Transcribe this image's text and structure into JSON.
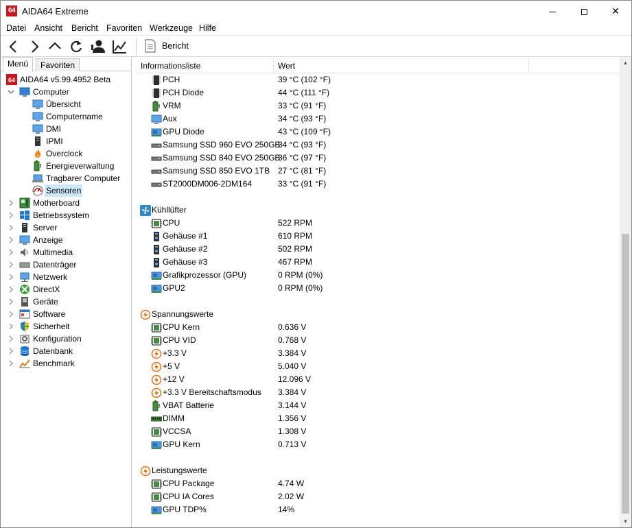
{
  "window": {
    "title": "AIDA64 Extreme",
    "logo_text": "64",
    "close_glyph": "✕"
  },
  "menubar": [
    "Datei",
    "Ansicht",
    "Bericht",
    "Favoriten",
    "Werkzeuge",
    "Hilfe"
  ],
  "toolbar": {
    "report_label": "Bericht",
    "icons": [
      "back-icon",
      "forward-icon",
      "up-icon",
      "refresh-icon",
      "user-icon",
      "chart-icon"
    ]
  },
  "left_panel": {
    "tabs": [
      "Menü",
      "Favoriten"
    ],
    "active_tab": "Menü",
    "tree": [
      {
        "label": "AIDA64 v5.99.4952 Beta",
        "level": 0,
        "icon": "aida64-icon"
      },
      {
        "label": "Computer",
        "level": 1,
        "icon": "computer-icon",
        "expanded": true
      },
      {
        "label": "Übersicht",
        "level": 2,
        "icon": "monitor-icon"
      },
      {
        "label": "Computername",
        "level": 2,
        "icon": "monitor-icon"
      },
      {
        "label": "DMI",
        "level": 2,
        "icon": "monitor-icon"
      },
      {
        "label": "IPMI",
        "level": 2,
        "icon": "server-icon"
      },
      {
        "label": "Overclock",
        "level": 2,
        "icon": "flame-icon"
      },
      {
        "label": "Energieverwaltung",
        "level": 2,
        "icon": "battery-icon"
      },
      {
        "label": "Tragbarer Computer",
        "level": 2,
        "icon": "laptop-icon"
      },
      {
        "label": "Sensoren",
        "level": 2,
        "icon": "gauge-icon",
        "selected": true
      },
      {
        "label": "Motherboard",
        "level": 1,
        "icon": "motherboard-icon"
      },
      {
        "label": "Betriebssystem",
        "level": 1,
        "icon": "windows-icon"
      },
      {
        "label": "Server",
        "level": 1,
        "icon": "server-icon"
      },
      {
        "label": "Anzeige",
        "level": 1,
        "icon": "monitor-icon"
      },
      {
        "label": "Multimedia",
        "level": 1,
        "icon": "speaker-icon"
      },
      {
        "label": "Datenträger",
        "level": 1,
        "icon": "disk-icon"
      },
      {
        "label": "Netzwerk",
        "level": 1,
        "icon": "network-icon"
      },
      {
        "label": "DirectX",
        "level": 1,
        "icon": "xbox-icon"
      },
      {
        "label": "Geräte",
        "level": 1,
        "icon": "device-icon"
      },
      {
        "label": "Software",
        "level": 1,
        "icon": "software-icon"
      },
      {
        "label": "Sicherheit",
        "level": 1,
        "icon": "shield-icon"
      },
      {
        "label": "Konfiguration",
        "level": 1,
        "icon": "config-icon"
      },
      {
        "label": "Datenbank",
        "level": 1,
        "icon": "database-icon"
      },
      {
        "label": "Benchmark",
        "level": 1,
        "icon": "benchmark-icon"
      }
    ]
  },
  "list": {
    "columns": [
      "Informationsliste",
      "Wert"
    ],
    "rows": [
      {
        "type": "item",
        "icon": "chip-icon",
        "name": "PCH",
        "value": "39 °C  (102 °F)"
      },
      {
        "type": "item",
        "icon": "chip-icon",
        "name": "PCH Diode",
        "value": "44 °C  (111 °F)"
      },
      {
        "type": "item",
        "icon": "battery-icon",
        "name": "VRM",
        "value": "33 °C  (91 °F)"
      },
      {
        "type": "item",
        "icon": "monitor-icon",
        "name": "Aux",
        "value": "34 °C  (93 °F)"
      },
      {
        "type": "item",
        "icon": "gpu-icon",
        "name": "GPU Diode",
        "value": "43 °C  (109 °F)"
      },
      {
        "type": "item",
        "icon": "drive-icon",
        "name": "Samsung SSD 960 EVO 250GB",
        "value": "34 °C  (93 °F)"
      },
      {
        "type": "item",
        "icon": "drive-icon",
        "name": "Samsung SSD 840 EVO 250GB",
        "value": "36 °C  (97 °F)"
      },
      {
        "type": "item",
        "icon": "drive-icon",
        "name": "Samsung SSD 850 EVO 1TB",
        "value": "27 °C  (81 °F)"
      },
      {
        "type": "item",
        "icon": "drive-icon",
        "name": "ST2000DM006-2DM164",
        "value": "33 °C  (91 °F)"
      },
      {
        "type": "spacer"
      },
      {
        "type": "group",
        "icon": "fan-icon",
        "name": "Kühllüfter"
      },
      {
        "type": "item",
        "icon": "cpu-icon",
        "name": "CPU",
        "value": "522 RPM"
      },
      {
        "type": "item",
        "icon": "case-icon",
        "name": "Gehäuse #1",
        "value": "610 RPM"
      },
      {
        "type": "item",
        "icon": "case-icon",
        "name": "Gehäuse #2",
        "value": "502 RPM"
      },
      {
        "type": "item",
        "icon": "case-icon",
        "name": "Gehäuse #3",
        "value": "467 RPM"
      },
      {
        "type": "item",
        "icon": "gpu-icon",
        "name": "Grafikprozessor (GPU)",
        "value": "0 RPM  (0%)"
      },
      {
        "type": "item",
        "icon": "gpu-icon",
        "name": "GPU2",
        "value": "0 RPM  (0%)"
      },
      {
        "type": "spacer"
      },
      {
        "type": "group",
        "icon": "voltage-icon",
        "name": "Spannungswerte"
      },
      {
        "type": "item",
        "icon": "cpu-icon",
        "name": "CPU Kern",
        "value": "0.636 V"
      },
      {
        "type": "item",
        "icon": "cpu-icon",
        "name": "CPU VID",
        "value": "0.768 V"
      },
      {
        "type": "item",
        "icon": "voltage-icon",
        "name": "+3.3 V",
        "value": "3.384 V"
      },
      {
        "type": "item",
        "icon": "voltage-icon",
        "name": "+5 V",
        "value": "5.040 V"
      },
      {
        "type": "item",
        "icon": "voltage-icon",
        "name": "+12 V",
        "value": "12.096 V"
      },
      {
        "type": "item",
        "icon": "voltage-icon",
        "name": "+3.3 V Bereitschaftsmodus",
        "value": "3.384 V"
      },
      {
        "type": "item",
        "icon": "battery-icon",
        "name": "VBAT Batterie",
        "value": "3.144 V"
      },
      {
        "type": "item",
        "icon": "dimm-icon",
        "name": "DIMM",
        "value": "1.356 V"
      },
      {
        "type": "item",
        "icon": "cpu-icon",
        "name": "VCCSA",
        "value": "1.308 V"
      },
      {
        "type": "item",
        "icon": "gpu-icon",
        "name": "GPU Kern",
        "value": "0.713 V"
      },
      {
        "type": "spacer"
      },
      {
        "type": "group",
        "icon": "voltage-icon",
        "name": "Leistungswerte"
      },
      {
        "type": "item",
        "icon": "cpu-icon",
        "name": "CPU Package",
        "value": "4.74 W"
      },
      {
        "type": "item",
        "icon": "cpu-icon",
        "name": "CPU IA Cores",
        "value": "2.02 W"
      },
      {
        "type": "item",
        "icon": "gpu-icon",
        "name": "GPU TDP%",
        "value": "14%"
      }
    ]
  },
  "colors": {
    "selection": "#cce8ff",
    "logo_red": "#c8161d",
    "chip_green": "#3f8f3f",
    "voltage_orange": "#e0741c",
    "monitor_blue": "#2f7fd6",
    "fan_blue": "#2a89c9"
  }
}
